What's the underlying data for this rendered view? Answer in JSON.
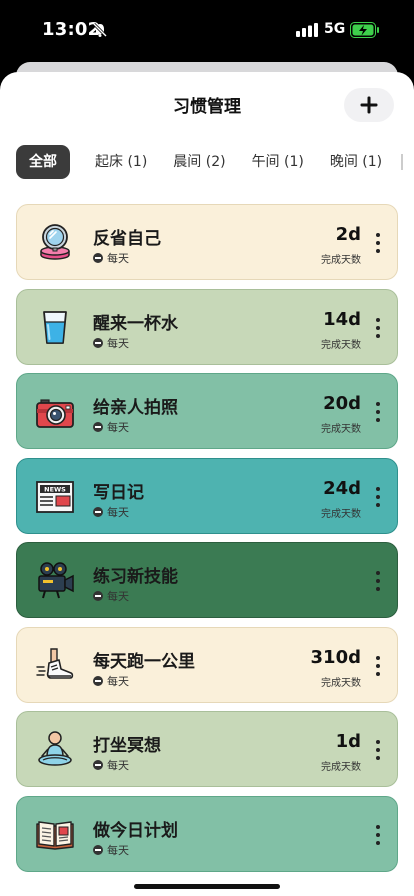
{
  "status": {
    "time": "13:02",
    "network": "5G"
  },
  "nav": {
    "title": "习惯管理",
    "add_icon": "plus-icon"
  },
  "tabs": [
    {
      "label": "全部",
      "active": true
    },
    {
      "label": "起床 (1)",
      "active": false
    },
    {
      "label": "晨间 (2)",
      "active": false
    },
    {
      "label": "午间 (1)",
      "active": false
    },
    {
      "label": "晚间 (1)",
      "active": false
    }
  ],
  "habits": [
    {
      "name": "反省自己",
      "frequency": "每天",
      "days": "2d",
      "days_label": "完成天数",
      "icon": "compact-mirror-icon",
      "color": "#faf0da"
    },
    {
      "name": "醒来一杯水",
      "frequency": "每天",
      "days": "14d",
      "days_label": "完成天数",
      "icon": "water-glass-icon",
      "color": "#c7d8b8"
    },
    {
      "name": "给亲人拍照",
      "frequency": "每天",
      "days": "20d",
      "days_label": "完成天数",
      "icon": "camera-icon",
      "color": "#82c0a6"
    },
    {
      "name": "写日记",
      "frequency": "每天",
      "days": "24d",
      "days_label": "完成天数",
      "icon": "newspaper-icon",
      "color": "#4eb3b0"
    },
    {
      "name": "练习新技能",
      "frequency": "每天",
      "days": "",
      "days_label": "",
      "icon": "video-camera-icon",
      "color": "#3b7b53"
    },
    {
      "name": "每天跑一公里",
      "frequency": "每天",
      "days": "310d",
      "days_label": "完成天数",
      "icon": "running-shoe-icon",
      "color": "#faf0da"
    },
    {
      "name": "打坐冥想",
      "frequency": "每天",
      "days": "1d",
      "days_label": "完成天数",
      "icon": "meditation-icon",
      "color": "#c7d8b8"
    },
    {
      "name": "做今日计划",
      "frequency": "每天",
      "days": "",
      "days_label": "",
      "icon": "open-book-icon",
      "color": "#82c0a6"
    }
  ]
}
